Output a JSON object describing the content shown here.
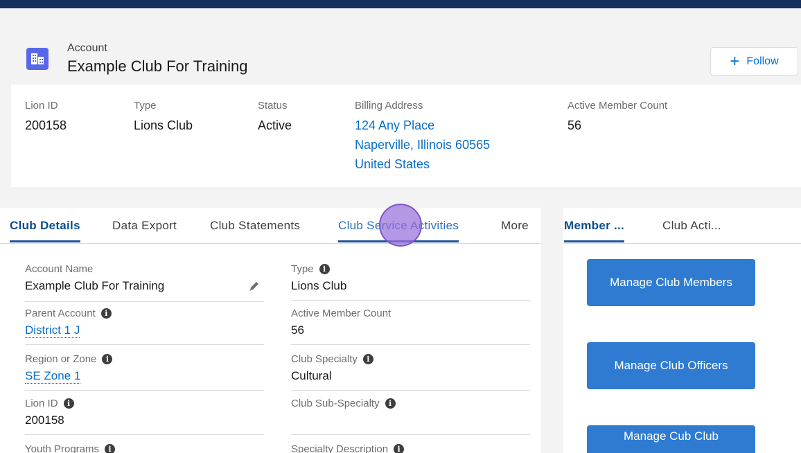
{
  "header": {
    "object_type": "Account",
    "record_name": "Example Club For Training",
    "follow_label": "Follow"
  },
  "highlights": [
    {
      "label": "Lion ID",
      "value": "200158"
    },
    {
      "label": "Type",
      "value": "Lions Club"
    },
    {
      "label": "Status",
      "value": "Active"
    },
    {
      "label": "Billing Address",
      "lines": [
        "124 Any Place",
        "Naperville, Illinois 60565",
        "United States"
      ]
    },
    {
      "label": "Active Member Count",
      "value": "56"
    }
  ],
  "tabs": [
    "Club Details",
    "Data Export",
    "Club Statements",
    "Club Service Activities",
    "More"
  ],
  "active_tab": "Club Details",
  "side_tabs": [
    "Member ...",
    "Club Acti..."
  ],
  "fields": {
    "account_name": {
      "label": "Account Name",
      "value": "Example Club For Training"
    },
    "type": {
      "label": "Type",
      "value": "Lions Club"
    },
    "parent_account": {
      "label": "Parent Account",
      "value": "District 1 J"
    },
    "active_member_count": {
      "label": "Active Member Count",
      "value": "56"
    },
    "region_or_zone": {
      "label": "Region or Zone",
      "value": "SE Zone 1"
    },
    "club_specialty": {
      "label": "Club Specialty",
      "value": "Cultural"
    },
    "lion_id": {
      "label": "Lion ID",
      "value": "200158"
    },
    "club_sub_specialty": {
      "label": "Club Sub-Specialty",
      "value": ""
    },
    "youth_programs": {
      "label": "Youth Programs"
    },
    "specialty_description": {
      "label": "Specialty Description"
    }
  },
  "actions": [
    "Manage Club Members",
    "Manage Club Officers",
    "Manage Cub Club"
  ],
  "colors": {
    "nav": "#16325c",
    "account_icon": "#5867e8",
    "link": "#0a6ec7",
    "button": "#2f7bd1",
    "cursor_highlight": "#976fdb"
  }
}
